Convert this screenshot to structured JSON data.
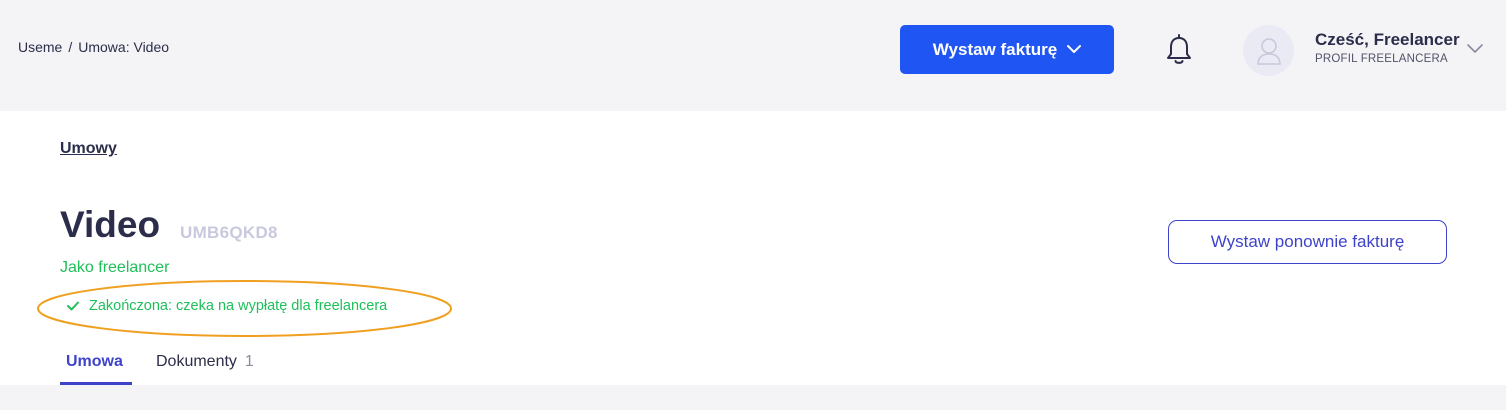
{
  "breadcrumb": {
    "root": "Useme",
    "separator": "/",
    "current": "Umowa: Video"
  },
  "header": {
    "primary_button": "Wystaw fakturę",
    "user_greeting": "Cześć, Freelancer",
    "user_role": "PROFIL FREELANCERA"
  },
  "contract": {
    "back_link": "Umowy",
    "title": "Video",
    "code": "UMB6QKD8",
    "role": "Jako freelancer",
    "status": "Zakończona: czeka na wypłatę dla freelancera",
    "reissue_button": "Wystaw ponownie fakturę"
  },
  "tabs": [
    {
      "label": "Umowa",
      "active": true
    },
    {
      "label": "Dokumenty",
      "count": "1",
      "active": false
    }
  ],
  "colors": {
    "primary": "#1f55f2",
    "accent": "#3f43c9",
    "success": "#1fbf5a",
    "highlight": "#f0a020"
  }
}
